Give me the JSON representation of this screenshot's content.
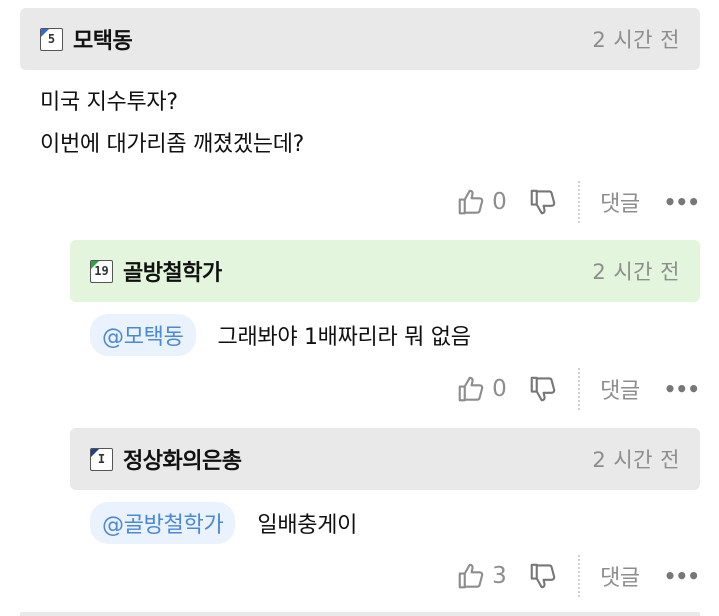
{
  "comments": [
    {
      "author": "모택동",
      "level_badge": "5",
      "time": "2 시간 전",
      "lines": [
        "미국 지수투자?",
        "이번에 대가리좀 깨졌겠는데?"
      ],
      "likes": "0",
      "reply_label": "댓글",
      "more_label": "•••"
    },
    {
      "author": "골방철학가",
      "level_badge": "19",
      "time": "2 시간 전",
      "mention": "@모택동",
      "text": "그래봐야 1배짜리라 뭐 없음",
      "likes": "0",
      "reply_label": "댓글",
      "more_label": "•••"
    },
    {
      "author": "정상화의은총",
      "level_badge": "I",
      "time": "2 시간 전",
      "mention": "@골방철학가",
      "text": "일배충게이",
      "likes": "3",
      "reply_label": "댓글",
      "more_label": "•••"
    }
  ],
  "colors": {
    "header_grey": "#e9e9e9",
    "header_green": "#e3f5dc",
    "mention_bg": "#eaf2fd",
    "mention_text": "#4a88d8",
    "muted": "#8d8d8d"
  },
  "icons": [
    "thumbs-up-icon",
    "thumbs-down-icon",
    "more-icon"
  ]
}
